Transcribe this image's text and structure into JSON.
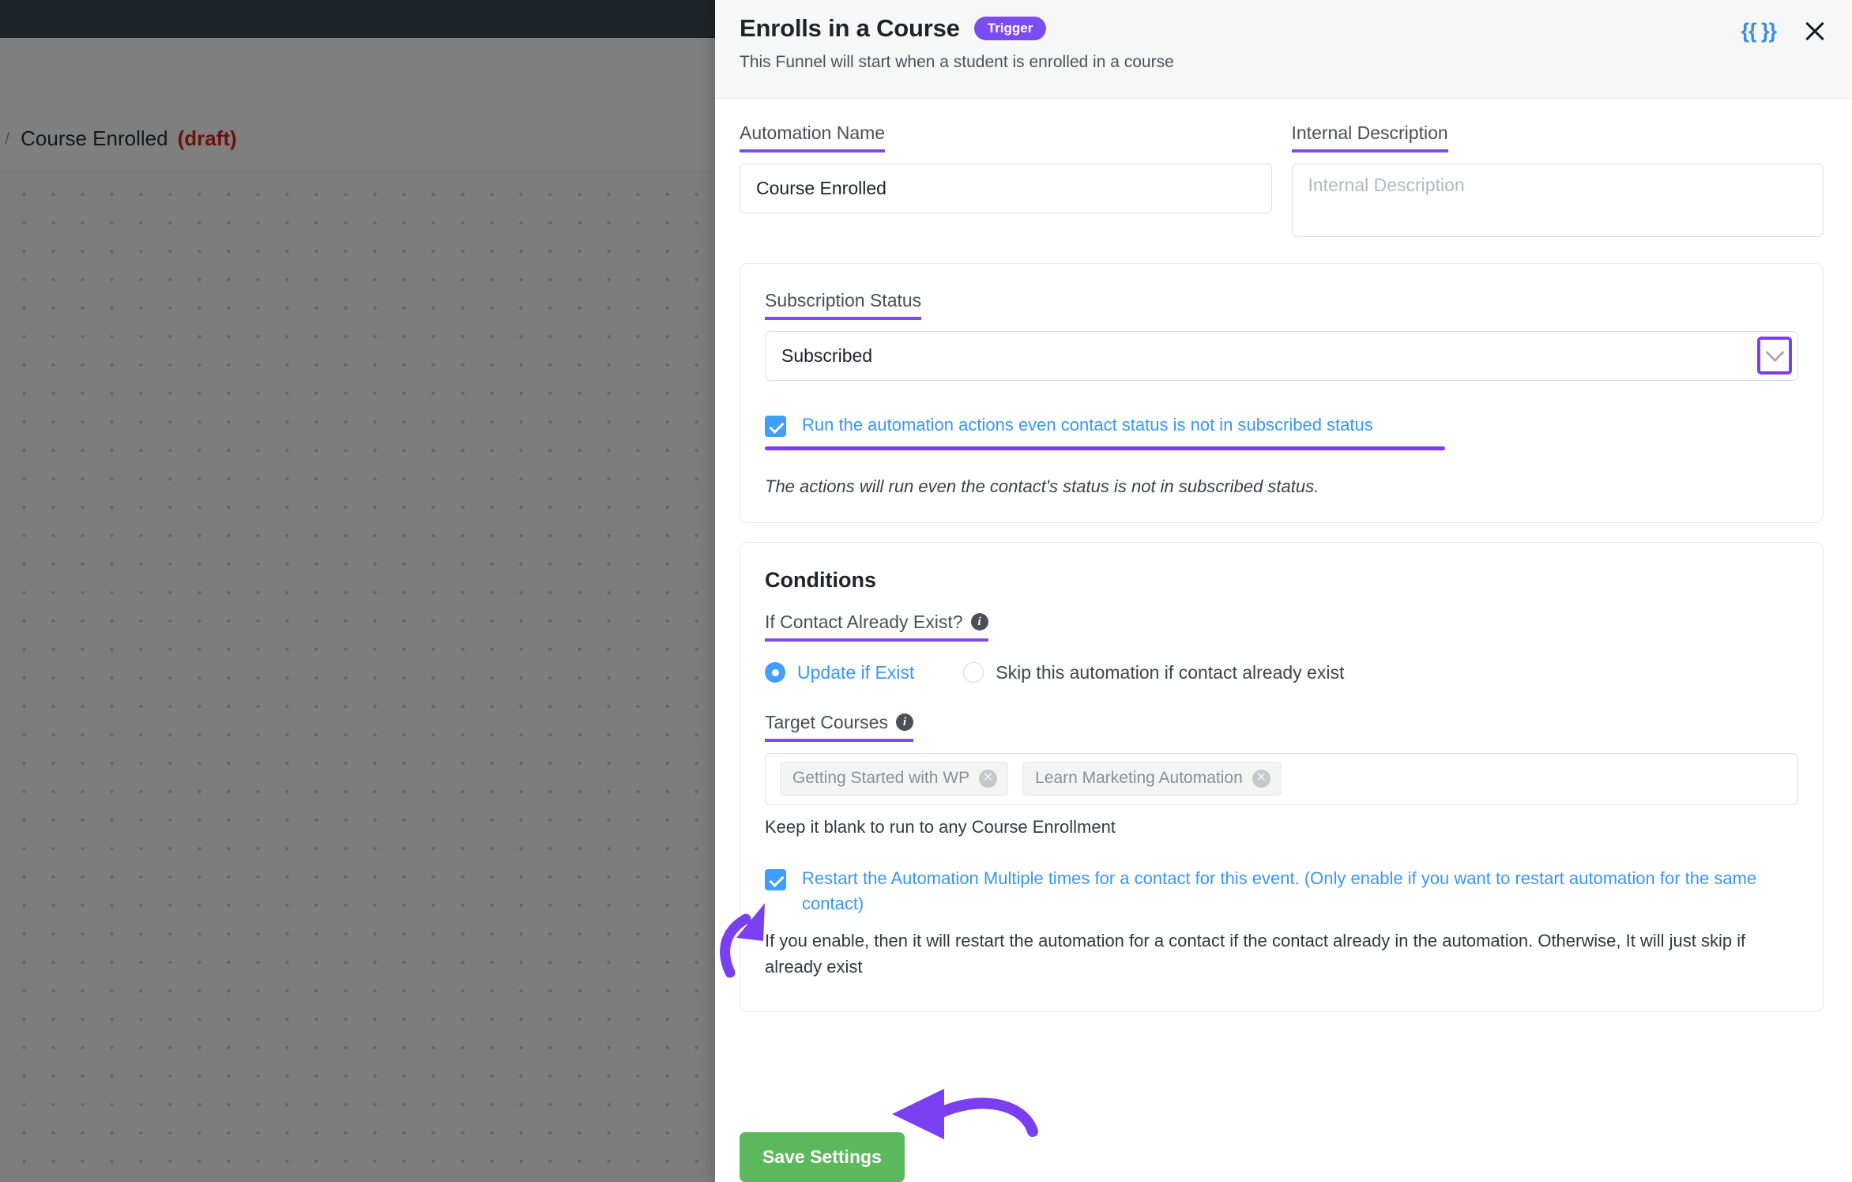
{
  "background": {
    "breadcrumb_separator": "/",
    "breadcrumb_title": "Course Enrolled",
    "breadcrumb_status": "(draft)"
  },
  "modal": {
    "title": "Enrolls in a Course",
    "badge": "Trigger",
    "subtitle": "This Funnel will start when a student is enrolled in a course",
    "smartcode_icon_label": "{{ }}",
    "close_icon_label": "close-icon"
  },
  "form": {
    "automation_name_label": "Automation Name",
    "automation_name_value": "Course Enrolled",
    "internal_description_label": "Internal Description",
    "internal_description_value": "",
    "internal_description_placeholder": "Internal Description"
  },
  "subscription": {
    "label": "Subscription Status",
    "selected": "Subscribed",
    "run_anyway_label": "Run the automation actions even contact status is not in subscribed status",
    "run_anyway_checked": true,
    "note": "The actions will run even the contact's status is not in subscribed status."
  },
  "conditions": {
    "title": "Conditions",
    "exist_label": "If Contact Already Exist?",
    "radio_update_label": "Update if Exist",
    "radio_skip_label": "Skip this automation if contact already exist",
    "radio_selected": "Update if Exist",
    "target_courses_label": "Target Courses",
    "target_courses": [
      "Getting Started with WP",
      "Learn Marketing Automation"
    ],
    "target_courses_hint": "Keep it blank to run to any Course Enrollment",
    "restart_label": "Restart the Automation Multiple times for a contact for this event. (Only enable if you want to restart automation for the same contact)",
    "restart_checked": true,
    "restart_helper": "If you enable, then it will restart the automation for a contact if the contact already in the automation. Otherwise, It will just skip if already exist"
  },
  "footer": {
    "save_label": "Save Settings"
  },
  "colors": {
    "accent_purple": "#7b3ff2",
    "link_blue": "#3a96f0",
    "save_green": "#5cb85c",
    "draft_red": "#d8251d"
  }
}
